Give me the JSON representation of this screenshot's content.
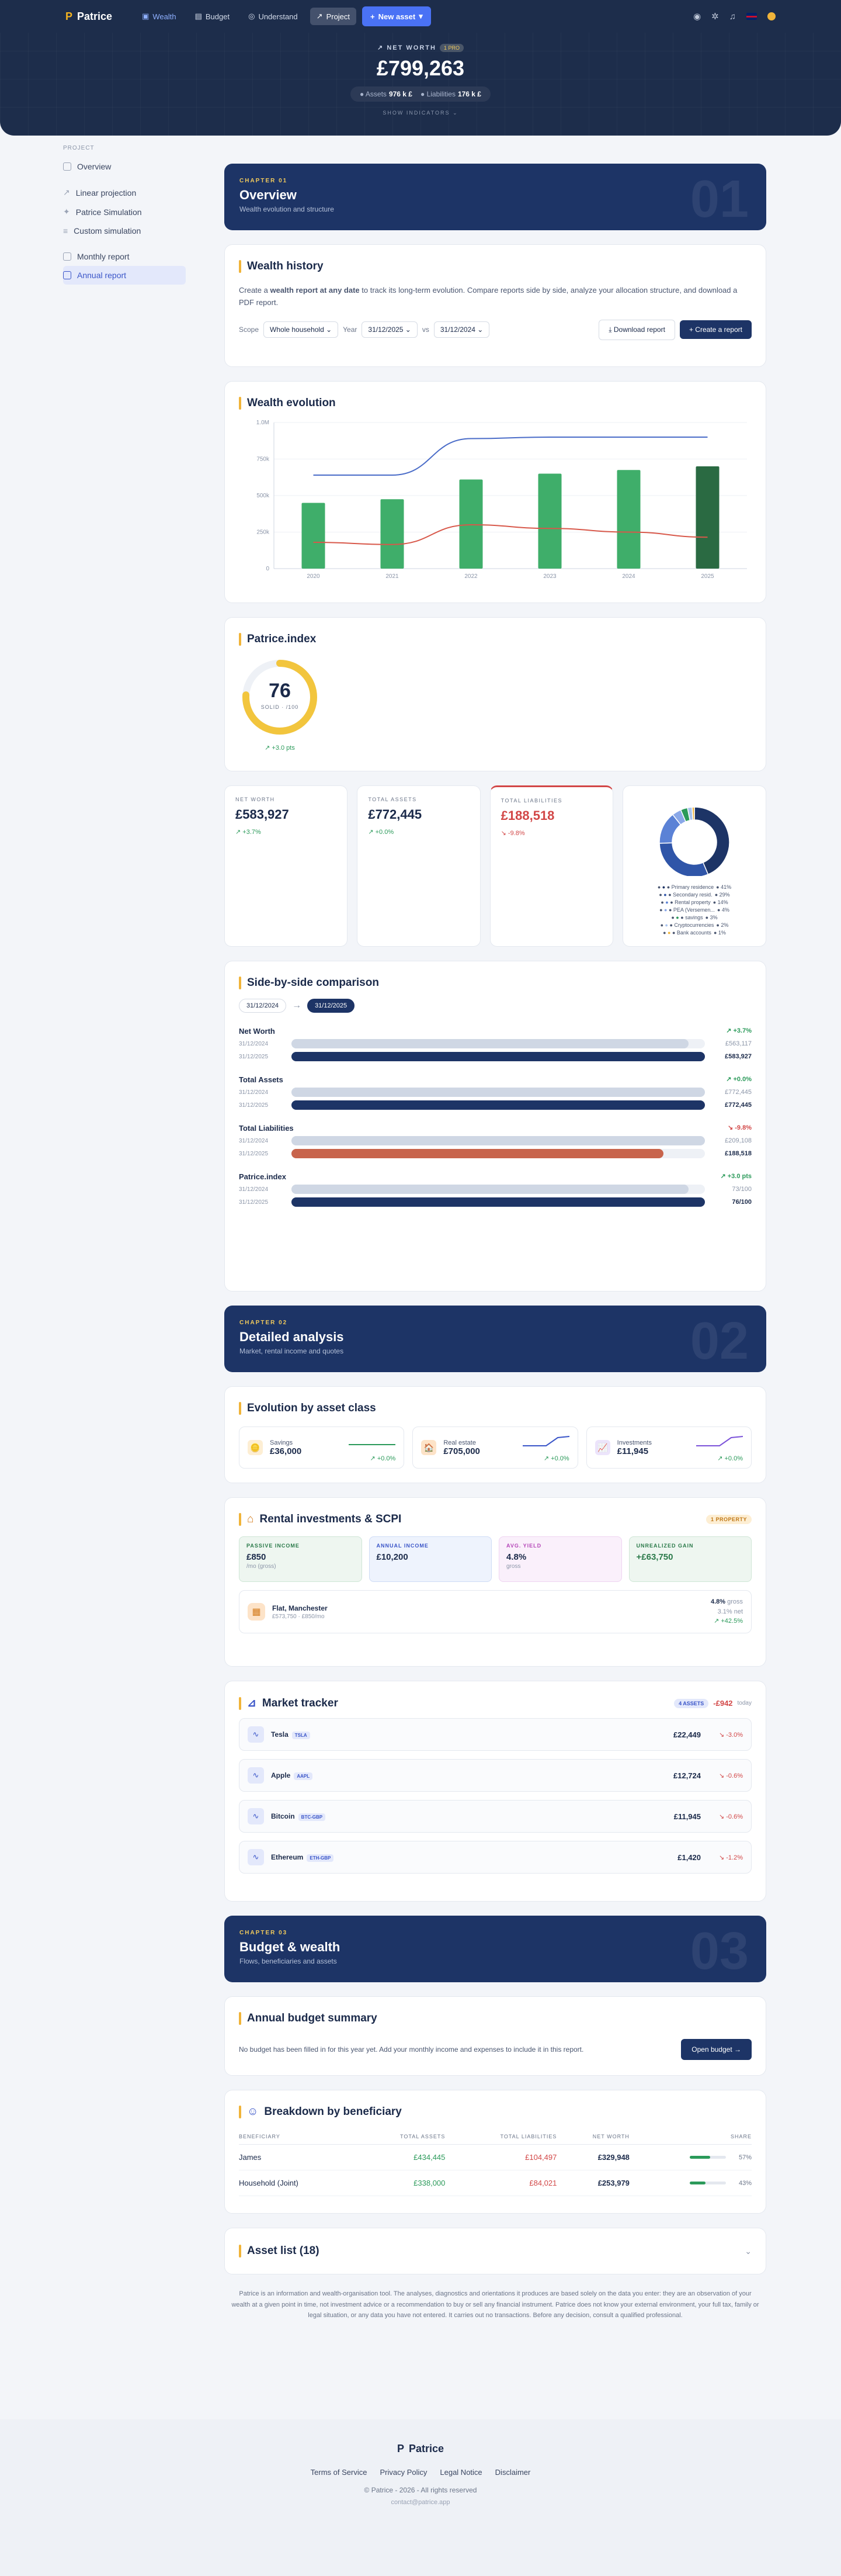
{
  "nav": {
    "brand": "Patrice",
    "tabs": [
      {
        "label": "Wealth"
      },
      {
        "label": "Budget"
      },
      {
        "label": "Understand"
      },
      {
        "label": "Project"
      }
    ],
    "new_asset": "New asset"
  },
  "hero": {
    "label": "NET WORTH",
    "badge": "1 PRO",
    "value": "£799,263",
    "assets_label": "Assets",
    "assets_value": "976 k £",
    "liab_label": "Liabilities",
    "liab_value": "176 k £",
    "show": "SHOW INDICATORS"
  },
  "sidebar": {
    "heading": "PROJECT",
    "items": [
      {
        "label": "Overview"
      },
      {
        "label": "Linear projection"
      },
      {
        "label": "Patrice Simulation"
      },
      {
        "label": "Custom simulation"
      },
      {
        "label": "Monthly report"
      },
      {
        "label": "Annual report"
      }
    ]
  },
  "ch1": {
    "num": "CHAPTER 01",
    "title": "Overview",
    "sub": "Wealth evolution and structure",
    "big": "01"
  },
  "history": {
    "title": "Wealth history",
    "desc_pre": "Create a ",
    "desc_bold": "wealth report at any date",
    "desc_post": " to track its long-term evolution. Compare reports side by side, analyze your allocation structure, and download a PDF report.",
    "scope_label": "Scope",
    "scope": "Whole household",
    "year_label": "Year",
    "date1": "31/12/2025",
    "vs": "vs",
    "date2": "31/12/2024",
    "download": "Download report",
    "create": "+ Create a report"
  },
  "evolution": {
    "title": "Wealth evolution"
  },
  "chart_data": {
    "type": "bar",
    "categories": [
      "2020",
      "2021",
      "2022",
      "2023",
      "2024",
      "2025"
    ],
    "series": [
      {
        "values": [
          450000,
          475000,
          610000,
          650000,
          675000,
          700000
        ]
      },
      {
        "values": [
          640000,
          640000,
          890000,
          900000,
          900000,
          900000
        ]
      },
      {
        "values": [
          180000,
          165000,
          300000,
          275000,
          250000,
          215000
        ]
      }
    ],
    "yticks": [
      "0",
      "250k",
      "500k",
      "750k",
      "1.0M"
    ],
    "ylim": [
      0,
      1000000
    ]
  },
  "pindex": {
    "title": "Patrice.index",
    "score": "76",
    "unit": "SOLID · /100",
    "change": "↗ +3.0 pts",
    "score_value": 76
  },
  "kpi": {
    "nw_label": "NET WORTH",
    "nw": "£583,927",
    "nw_chg": "↗ +3.7%",
    "ta_label": "TOTAL ASSETS",
    "ta": "£772,445",
    "ta_chg": "↗ +0.0%",
    "tl_label": "TOTAL LIABILITIES",
    "tl": "£188,518",
    "tl_chg": "↘ -9.8%"
  },
  "donut": {
    "legend": [
      {
        "label": "Primary residence",
        "pct": "41%",
        "color": "#1d3466"
      },
      {
        "label": "Secondary resid.",
        "pct": "29%",
        "color": "#2f55a8"
      },
      {
        "label": "Rental property",
        "pct": "14%",
        "color": "#5b82d6"
      },
      {
        "label": "PEA (Versemen...",
        "pct": "4%",
        "color": "#8aa8e8"
      },
      {
        "label": "savings",
        "pct": "3%",
        "color": "#2b9a5a"
      },
      {
        "label": "Cryptocurrencies",
        "pct": "2%",
        "color": "#a8c3ee"
      },
      {
        "label": "Bank accounts",
        "pct": "1%",
        "color": "#f0b43a"
      }
    ],
    "values": [
      41,
      29,
      14,
      4,
      3,
      2,
      1
    ]
  },
  "compare": {
    "title": "Side-by-side comparison",
    "d1": "31/12/2024",
    "arrow": "→",
    "d2": "31/12/2025",
    "rows": [
      {
        "label": "Net Worth",
        "chg": "↗ +3.7%",
        "d1": "31/12/2024",
        "v1": "£563,117",
        "d2": "31/12/2025",
        "v2": "£583,927",
        "f1": 0.96,
        "f2": 1.0,
        "color": "#1d3466",
        "chg_class": "green"
      },
      {
        "label": "Total Assets",
        "chg": "↗ +0.0%",
        "d1": "31/12/2024",
        "v1": "£772,445",
        "d2": "31/12/2025",
        "v2": "£772,445",
        "f1": 1.0,
        "f2": 1.0,
        "color": "#1d3466",
        "chg_class": "green"
      },
      {
        "label": "Total Liabilities",
        "chg": "↘ -9.8%",
        "d1": "31/12/2024",
        "v1": "£209,108",
        "d2": "31/12/2025",
        "v2": "£188,518",
        "f1": 1.0,
        "f2": 0.9,
        "color": "#c8644c",
        "chg_class": "red"
      },
      {
        "label": "Patrice.index",
        "chg": "↗ +3.0 pts",
        "d1": "31/12/2024",
        "v1": "73/100",
        "d2": "31/12/2025",
        "v2": "76/100",
        "f1": 0.96,
        "f2": 1.0,
        "color": "#1d3466",
        "chg_class": "green"
      }
    ]
  },
  "ch2": {
    "num": "CHAPTER 02",
    "title": "Detailed analysis",
    "sub": "Market, rental income and quotes",
    "big": "02"
  },
  "assetclass": {
    "title": "Evolution by asset class",
    "items": [
      {
        "name": "Savings",
        "value": "£36,000",
        "chg": "↗ +0.0%",
        "icon": "🪙"
      },
      {
        "name": "Real estate",
        "value": "£705,000",
        "chg": "↗ +0.0%",
        "icon": "🏠"
      },
      {
        "name": "Investments",
        "value": "£11,945",
        "chg": "↗ +0.0%",
        "icon": "📈"
      }
    ]
  },
  "rental": {
    "title": "Rental investments & SCPI",
    "badge": "1 PROPERTY",
    "cards": [
      {
        "label": "PASSIVE INCOME",
        "value": "£850",
        "sub": "/mo (gross)"
      },
      {
        "label": "ANNUAL INCOME",
        "value": "£10,200",
        "sub": ""
      },
      {
        "label": "AVG. YIELD",
        "value": "4.8%",
        "sub": "gross"
      },
      {
        "label": "UNREALIZED GAIN",
        "value": "+£63,750",
        "sub": ""
      }
    ],
    "prop_name": "Flat, Manchester",
    "prop_sub": "£573,750 · £850/mo",
    "prop_yield": "4.8%",
    "prop_yield_sub": "gross",
    "prop_rate": "3.1% net",
    "prop_gain": "↗ +42.5%"
  },
  "market": {
    "title": "Market tracker",
    "assets_badge": "4 ASSETS",
    "total": "-£942",
    "today": "today",
    "rows": [
      {
        "name": "Tesla",
        "tkr": "TSLA",
        "val": "£22,449",
        "chg": "↘ -3.0%"
      },
      {
        "name": "Apple",
        "tkr": "AAPL",
        "val": "£12,724",
        "chg": "↘ -0.6%"
      },
      {
        "name": "Bitcoin",
        "tkr": "BTC-GBP",
        "val": "£11,945",
        "chg": "↘ -0.6%"
      },
      {
        "name": "Ethereum",
        "tkr": "ETH-GBP",
        "val": "£1,420",
        "chg": "↘ -1.2%"
      }
    ]
  },
  "ch3": {
    "num": "CHAPTER 03",
    "title": "Budget & wealth",
    "sub": "Flows, beneficiaries and assets",
    "big": "03"
  },
  "budget": {
    "title": "Annual budget summary",
    "text": "No budget has been filled in for this year yet. Add your monthly income and expenses to include it in this report.",
    "btn": "Open budget →"
  },
  "benef": {
    "title": "Breakdown by beneficiary",
    "cols": [
      "BENEFICIARY",
      "TOTAL ASSETS",
      "TOTAL LIABILITIES",
      "NET WORTH",
      "SHARE"
    ],
    "rows": [
      {
        "name": "James",
        "assets": "£434,445",
        "liab": "£104,497",
        "nw": "£329,948",
        "share": "57%",
        "share_value": 57
      },
      {
        "name": "Household (Joint)",
        "assets": "£338,000",
        "liab": "£84,021",
        "nw": "£253,979",
        "share": "43%",
        "share_value": 43
      }
    ]
  },
  "assetlist": {
    "title": "Asset list (18)"
  },
  "disclaimer": "Patrice is an information and wealth-organisation tool. The analyses, diagnostics and orientations it produces are based solely on the data you enter: they are an observation of your wealth at a given point in time, not investment advice or a recommendation to buy or sell any financial instrument. Patrice does not know your external environment, your full tax, family or legal situation, or any data you have not entered. It carries out no transactions. Before any decision, consult a qualified professional.",
  "footer": {
    "brand": "Patrice",
    "links": [
      "Terms of Service",
      "Privacy Policy",
      "Legal Notice",
      "Disclaimer"
    ],
    "copy": "© Patrice - 2026 - All rights reserved",
    "mail": "contact@patrice.app"
  }
}
